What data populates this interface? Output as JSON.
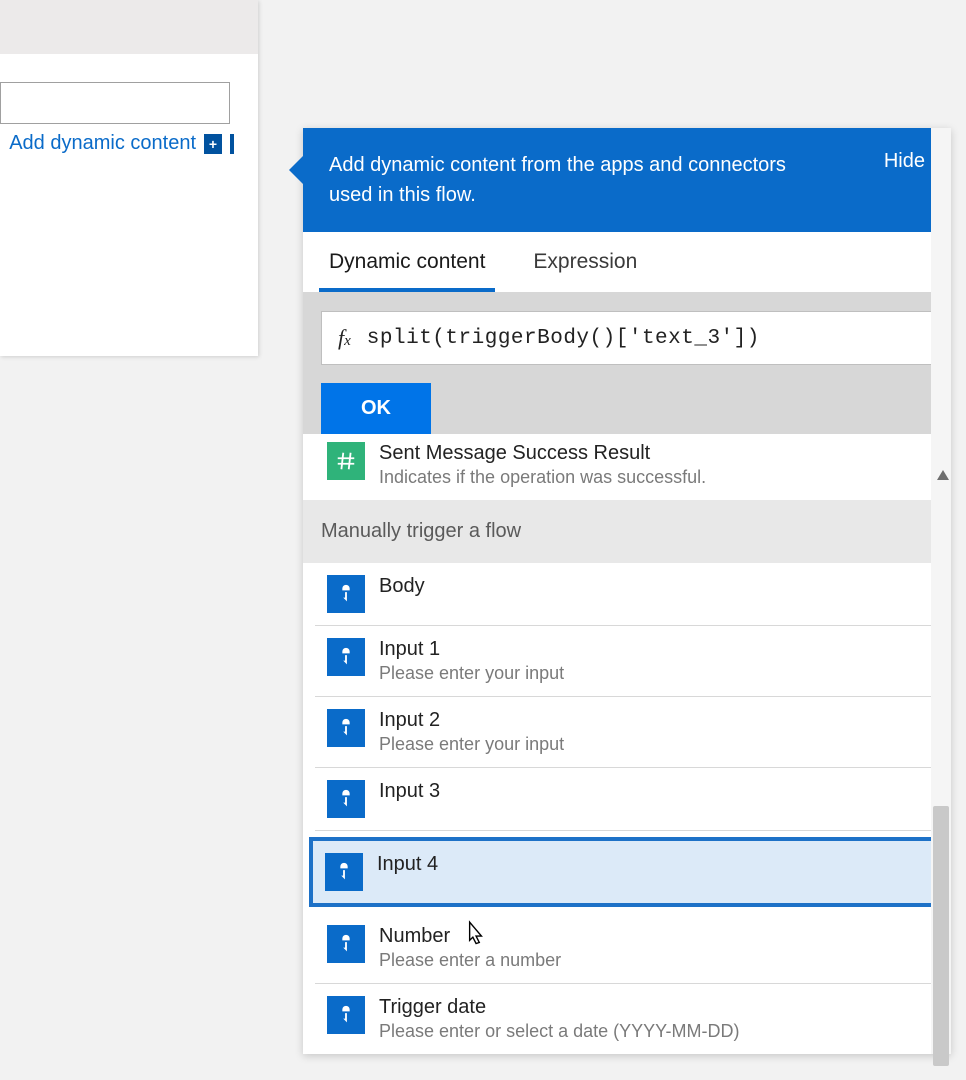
{
  "left": {
    "add_label": "Add dynamic content"
  },
  "flyout": {
    "header_text": "Add dynamic content from the apps and connectors used in this flow.",
    "hide_label": "Hide",
    "tabs": {
      "dynamic": "Dynamic content",
      "expression": "Expression"
    },
    "fx_label": "fx",
    "fx_expression": "split(triggerBody()['text_3'])",
    "ok_label": "OK",
    "first_item": {
      "title": "Sent Message Success Result",
      "sub": "Indicates if the operation was successful."
    },
    "section_label": "Manually trigger a flow",
    "items": [
      {
        "title": "Body",
        "sub": ""
      },
      {
        "title": "Input 1",
        "sub": "Please enter your input"
      },
      {
        "title": "Input 2",
        "sub": "Please enter your input"
      },
      {
        "title": "Input 3",
        "sub": ""
      },
      {
        "title": "Input 4",
        "sub": ""
      },
      {
        "title": "Number",
        "sub": "Please enter a number"
      },
      {
        "title": "Trigger date",
        "sub": "Please enter or select a date (YYYY-MM-DD)"
      }
    ]
  }
}
